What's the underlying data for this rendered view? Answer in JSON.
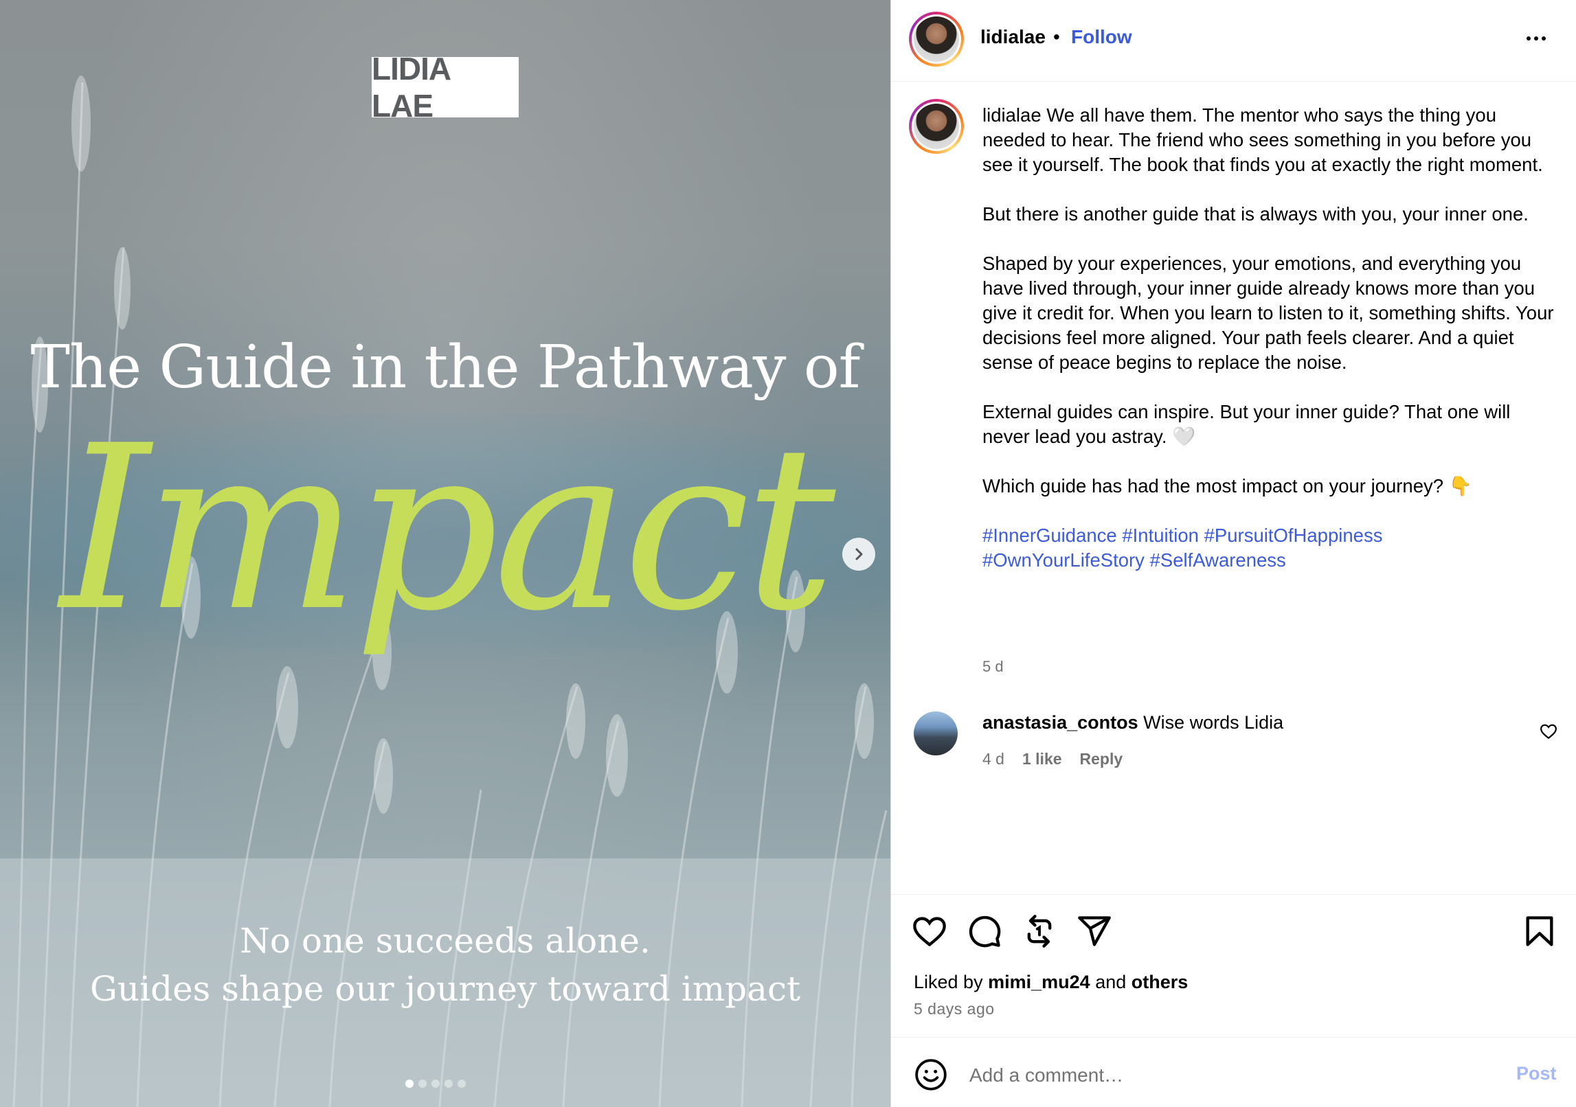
{
  "post": {
    "brand_label": "LIDIA LAE",
    "title_line": "The Guide in the Pathway of",
    "title_script": "Impact",
    "subtitle_1": "No one succeeds alone.",
    "subtitle_2": "Guides shape our journey toward impact",
    "carousel": {
      "total_slides": 5,
      "active_index": 0
    }
  },
  "header": {
    "username": "lidialae",
    "separator": "•",
    "follow_label": "Follow"
  },
  "caption": {
    "username": "lidialae",
    "para1": "We all have them. The mentor who says the thing you needed to hear. The friend who sees something in you before you see it yourself. The book that finds you at exactly the right moment.",
    "para2": "But there is another guide that is always with you, your inner one.",
    "para3": "Shaped by your experiences, your emotions, and everything you have lived through, your inner guide already knows more than you give it credit for. When you learn to listen to it, something shifts. Your decisions feel more aligned. Your path feels clearer. And a quiet sense of peace begins to replace the noise.",
    "para4": "External guides can inspire. But your inner guide? That one will never lead you astray. 🤍",
    "para5": "Which guide has had the most impact on your journey? 👇",
    "hashtags": [
      "#InnerGuidance",
      "#Intuition",
      "#PursuitOfHappiness",
      "#OwnYourLifeStory",
      "#SelfAwareness"
    ],
    "time": "5 d"
  },
  "comments": [
    {
      "username": "anastasia_contos",
      "text": "Wise words Lidia",
      "time": "4 d",
      "likes": "1 like",
      "reply_label": "Reply"
    }
  ],
  "footer": {
    "liked_prefix": "Liked by",
    "liked_user": "mimi_mu24",
    "liked_and": "and",
    "liked_others": "others",
    "days_ago": "5 days ago",
    "comment_placeholder": "Add a comment…",
    "post_label": "Post"
  },
  "colors": {
    "link_blue": "#3b5bdb",
    "script_green": "#c6dd5a",
    "post_disabled": "#a5b8f3",
    "muted_gray": "#737373"
  },
  "icons": [
    "heart-icon",
    "comment-icon",
    "repost-icon",
    "share-icon",
    "bookmark-icon",
    "emoji-icon",
    "chevron-right-icon",
    "more-icon"
  ]
}
